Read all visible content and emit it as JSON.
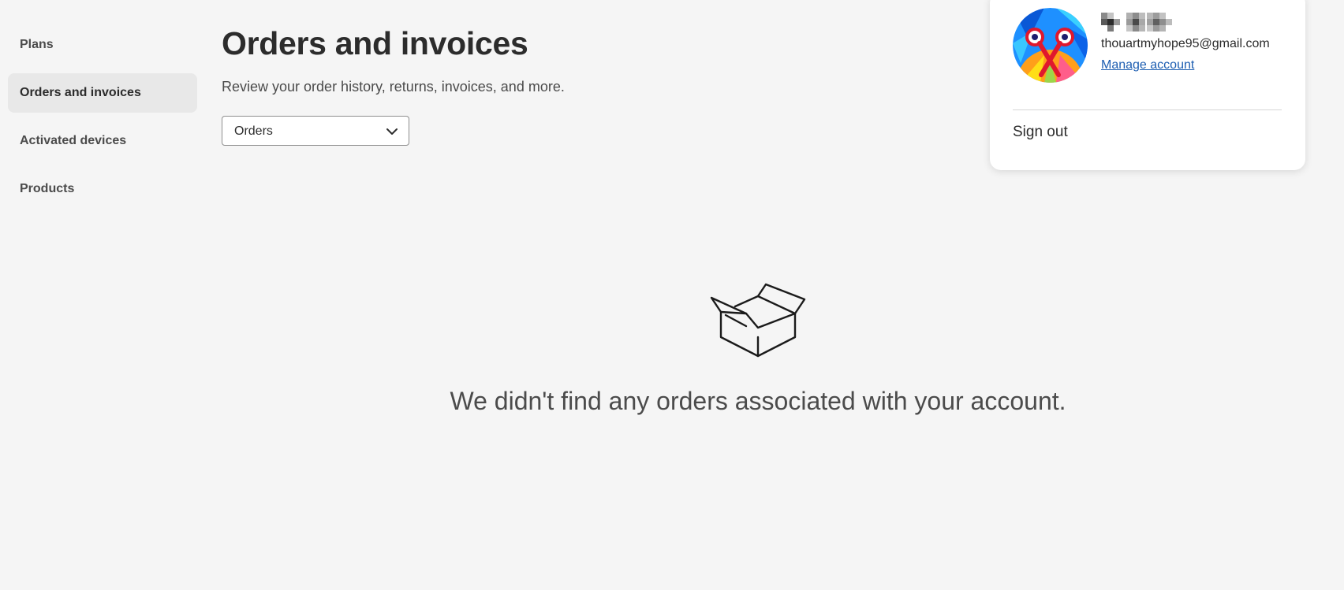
{
  "sidebar": {
    "items": [
      {
        "label": "Plans"
      },
      {
        "label": "Orders and invoices",
        "active": true
      },
      {
        "label": "Activated devices"
      },
      {
        "label": "Products"
      }
    ]
  },
  "main": {
    "title": "Orders and invoices",
    "subtitle": "Review your order history, returns, invoices, and more.",
    "filter": {
      "selected": "Orders",
      "icon": "chevron-down-icon"
    },
    "empty_state": {
      "icon": "open-box-icon",
      "message": "We didn't find any orders associated with your account."
    }
  },
  "account_menu": {
    "email": "thouartmyhope95@gmail.com",
    "manage_label": "Manage account",
    "sign_out_label": "Sign out",
    "name_redacted": true,
    "link_color": "#1c5db1"
  }
}
